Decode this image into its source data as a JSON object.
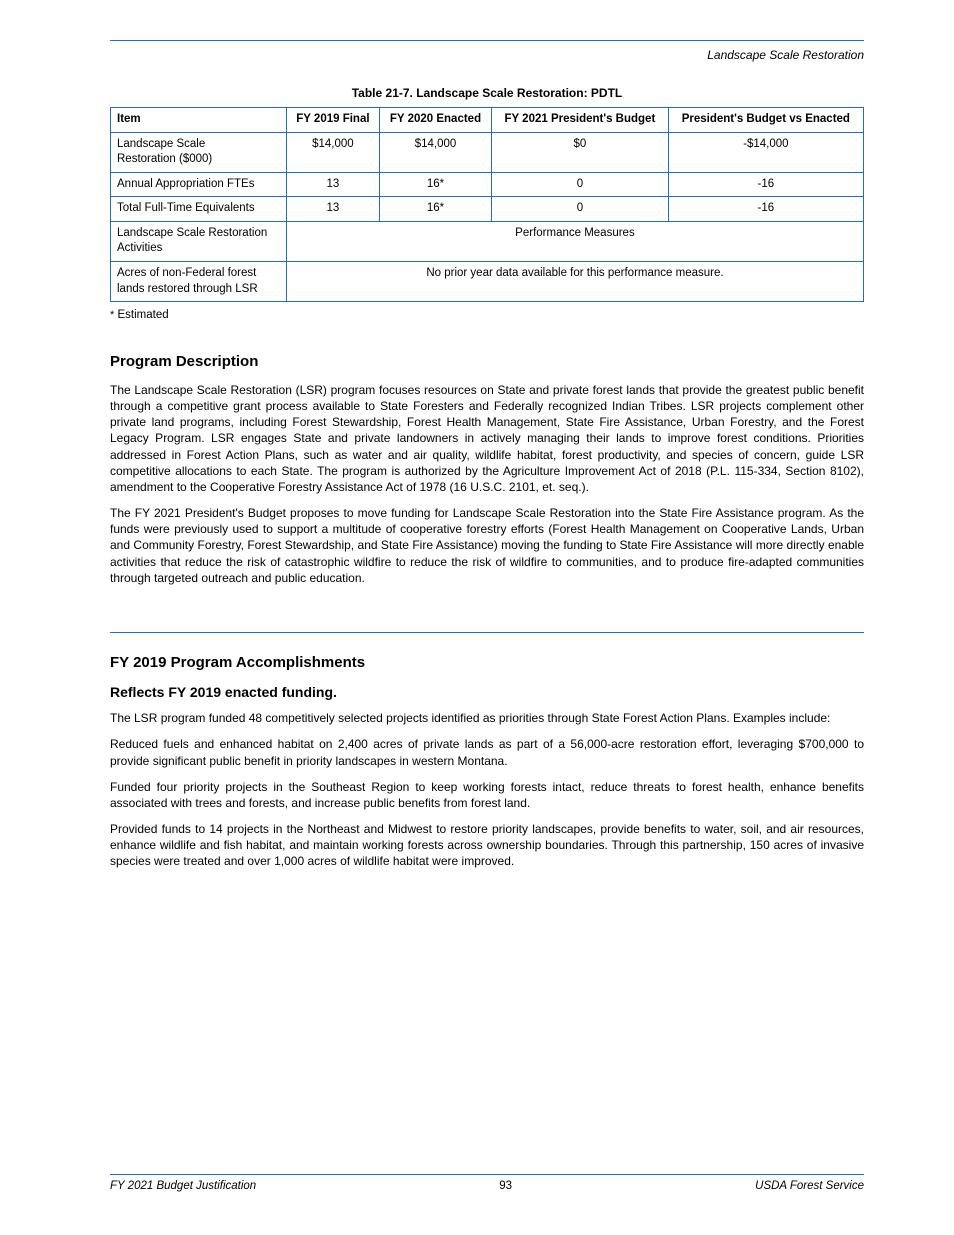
{
  "header": {
    "right_italic": "Landscape Scale Restoration"
  },
  "table": {
    "title": "Table 21-7. Landscape Scale Restoration: PDTL",
    "columns": [
      "Item",
      "FY 2019 Final",
      "FY 2020 Enacted",
      "FY 2021 President's Budget",
      "President's Budget vs Enacted"
    ],
    "rows": [
      {
        "label_html": "Landscape Scale<br>Restoration ($000)",
        "cells": [
          "$14,000",
          "$14,000",
          "$0",
          "-$14,000"
        ],
        "colspan_note": false
      },
      {
        "label": "Annual Appropriation FTEs",
        "cells": [
          "13",
          "16*",
          "0",
          "-16"
        ]
      },
      {
        "label": "Total Full-Time Equivalents",
        "cells": [
          "13",
          "16*",
          "0",
          "-16"
        ]
      },
      {
        "label_html": "Landscape Scale Restoration<br>Activities",
        "merged_text": "Performance Measures",
        "merged": true
      },
      {
        "label_html": "Acres of non-Federal forest<br>lands restored through LSR",
        "cells": [
          "No prior year data available for this performance measure."
        ],
        "merged": true
      }
    ],
    "footnote": "* Estimated"
  },
  "section1": {
    "heading": "Program Description",
    "paragraphs": [
      "The Landscape Scale Restoration (LSR) program focuses resources on State and private forest lands that provide the greatest public benefit through a competitive grant process available to State Foresters and Federally recognized Indian Tribes. LSR projects complement other private land programs, including Forest Stewardship, Forest Health Management, State Fire Assistance, Urban Forestry, and the Forest Legacy Program. LSR engages State and private landowners in actively managing their lands to improve forest conditions. Priorities addressed in Forest Action Plans, such as water and air quality, wildlife habitat, forest productivity, and species of concern, guide LSR competitive allocations to each State. The program is authorized by the Agriculture Improvement Act of 2018 (P.L. 115-334, Section 8102), amendment to the Cooperative Forestry Assistance Act of 1978 (16 U.S.C. 2101, et. seq.).",
      "The FY 2021 President's Budget proposes to move funding for Landscape Scale Restoration into the State Fire Assistance program. As the funds were previously used to support a multitude of cooperative forestry efforts (Forest Health Management on Cooperative Lands, Urban and Community Forestry, Forest Stewardship, and State Fire Assistance) moving the funding to State Fire Assistance will more directly enable activities that reduce the risk of catastrophic wildfire to reduce the risk of wildfire to communities, and to produce fire-adapted communities through targeted outreach and public education."
    ]
  },
  "section2": {
    "heading": "FY 2019 Program Accomplishments",
    "sub_heading": "Reflects FY 2019 enacted funding.",
    "paragraphs": [
      "The LSR program funded 48 competitively selected projects identified as priorities through State Forest Action Plans. Examples include:",
      "Reduced fuels and enhanced habitat on 2,400 acres of private lands as part of a 56,000-acre restoration effort, leveraging $700,000 to provide significant public benefit in priority landscapes in western Montana.",
      "Funded four priority projects in the Southeast Region to keep working forests intact, reduce threats to forest health, enhance benefits associated with trees and forests, and increase public benefits from forest land.",
      "Provided funds to 14 projects in the Northeast and Midwest to restore priority landscapes, provide benefits to water, soil, and air resources, enhance wildlife and fish habitat, and maintain working forests across ownership boundaries. Through this partnership, 150 acres of invasive species were treated and over 1,000 acres of wildlife habitat were improved."
    ]
  },
  "footer": {
    "left": "FY 2021 Budget Justification",
    "center": "93",
    "right": "USDA Forest Service"
  }
}
